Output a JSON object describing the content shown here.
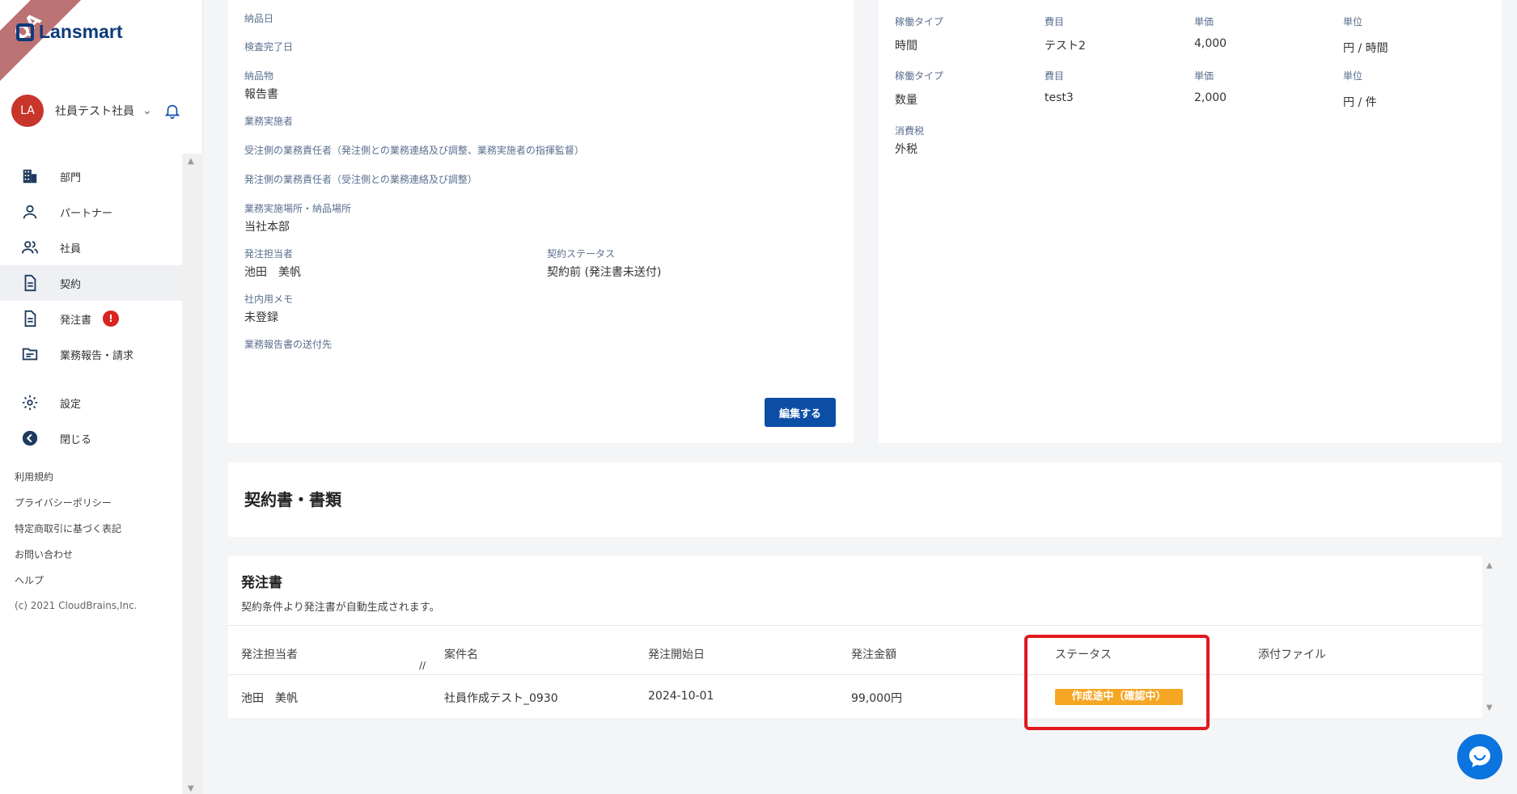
{
  "ribbon": "QA",
  "brand": {
    "name": "Lansmart"
  },
  "user": {
    "initials": "LA",
    "name": "社員テスト社員"
  },
  "nav": {
    "items": [
      {
        "label": "部門",
        "icon": "building-icon"
      },
      {
        "label": "パートナー",
        "icon": "person-icon"
      },
      {
        "label": "社員",
        "icon": "people-icon"
      },
      {
        "label": "契約",
        "icon": "document-icon"
      },
      {
        "label": "発注書",
        "icon": "document-icon",
        "badge": "!"
      },
      {
        "label": "業務報告・請求",
        "icon": "folder-icon"
      }
    ],
    "settings": "設定",
    "close": "閉じる"
  },
  "footer": {
    "terms": "利用規約",
    "privacy": "プライバシーポリシー",
    "tokusho": "特定商取引に基づく表記",
    "contact": "お問い合わせ",
    "help": "ヘルプ",
    "copyright": "(c) 2021 CloudBrains,Inc."
  },
  "contract": {
    "delivery_date_label": "納品日",
    "inspection_date_label": "検査完了日",
    "deliverable_label": "納品物",
    "deliverable_value": "報告書",
    "worker_label": "業務実施者",
    "receiver_manager_label": "受注側の業務責任者（発注側との業務連絡及び調整、業務実施者の指揮監督）",
    "orderer_manager_label": "発注側の業務責任者（受注側との業務連絡及び調整）",
    "location_label": "業務実施場所・納品場所",
    "location_value": "当社本部",
    "person_label": "発注担当者",
    "person_value": "池田　美帆",
    "status_label": "契約ステータス",
    "status_value": "契約前 (発注書未送付)",
    "memo_label": "社内用メモ",
    "memo_value": "未登録",
    "report_dest_label": "業務報告書の送付先",
    "edit_button": "編集する"
  },
  "rates": {
    "rows": [
      {
        "type_label": "稼働タイプ",
        "type": "時間",
        "item_label": "費目",
        "item": "テスト2",
        "price_label": "単価",
        "price": "4,000",
        "unit_label": "単位",
        "unit": "円 / 時間"
      },
      {
        "type_label": "稼働タイプ",
        "type": "数量",
        "item_label": "費目",
        "item": "test3",
        "price_label": "単価",
        "price": "2,000",
        "unit_label": "単位",
        "unit": "円 / 件"
      }
    ],
    "tax_label": "消費税",
    "tax_value": "外税"
  },
  "docs": {
    "title": "契約書・書類"
  },
  "orders": {
    "title": "発注書",
    "subtitle": "契約条件より発注書が自動生成されます。",
    "columns": [
      "発注担当者",
      "案件名",
      "発注開始日",
      "発注金額",
      "ステータス",
      "添付ファイル"
    ],
    "rows": [
      {
        "person": "池田　美帆",
        "project": "社員作成テスト_0930",
        "start": "2024-10-01",
        "amount": "99,000円",
        "status": "作成途中（確認中）",
        "attachment": ""
      }
    ]
  },
  "colors": {
    "primary": "#0c4ea6",
    "status_orange": "#f5a623",
    "highlight_red": "#e0191f",
    "avatar_red": "#c8352b"
  }
}
